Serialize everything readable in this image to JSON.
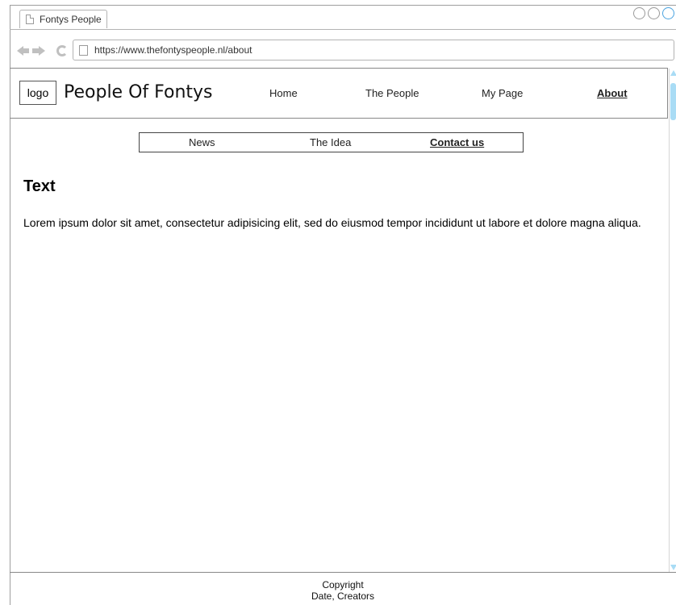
{
  "browser": {
    "tab_title": "Fontys People",
    "url": "https://www.thefontyspeople.nl/about"
  },
  "header": {
    "logo": "logo",
    "title": "People Of Fontys",
    "nav": [
      {
        "label": "Home",
        "active": false
      },
      {
        "label": "The People",
        "active": false
      },
      {
        "label": "My Page",
        "active": false
      },
      {
        "label": "About",
        "active": true
      }
    ]
  },
  "subnav": {
    "items": [
      {
        "label": "News",
        "active": false
      },
      {
        "label": "The Idea",
        "active": false
      },
      {
        "label": "Contact us",
        "active": true
      }
    ]
  },
  "content": {
    "heading": "Text",
    "body": "Lorem ipsum dolor sit amet, consectetur adipisicing elit, sed do eiusmod tempor incididunt ut labore et dolore magna aliqua."
  },
  "footer": {
    "line1": "Copyright",
    "line2": "Date, Creators"
  },
  "colors": {
    "scrollbar_accent": "#a9dcf5",
    "border": "#888888"
  }
}
